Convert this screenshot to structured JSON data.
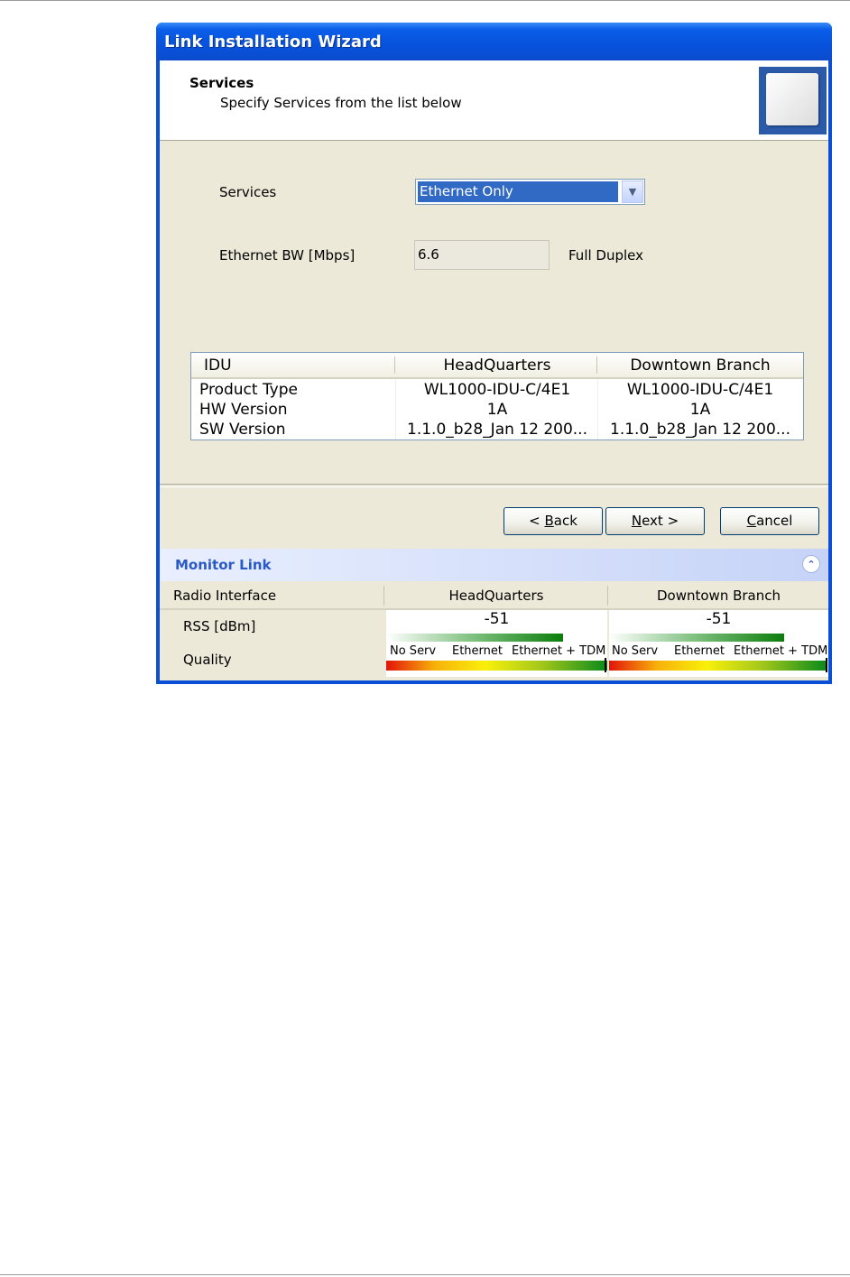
{
  "window": {
    "title": "Link Installation Wizard"
  },
  "header": {
    "title": "Services",
    "subtitle": "Specify Services from the list below"
  },
  "form": {
    "services_label": "Services",
    "services_value": "Ethernet Only",
    "bw_label": "Ethernet BW [Mbps]",
    "bw_value": "6.6",
    "duplex_label": "Full Duplex"
  },
  "idu_table": {
    "headers": [
      "IDU",
      "HeadQuarters",
      "Downtown Branch"
    ],
    "rows": [
      [
        "Product Type",
        "WL1000-IDU-C/4E1",
        "WL1000-IDU-C/4E1"
      ],
      [
        "HW Version",
        "1A",
        "1A"
      ],
      [
        "SW Version",
        "1.1.0_b28_Jan 12 200...",
        "1.1.0_b28_Jan 12 200..."
      ]
    ]
  },
  "buttons": {
    "back": {
      "pre": "< ",
      "accel": "B",
      "rest": "ack"
    },
    "next": {
      "pre": "",
      "accel": "N",
      "rest": "ext >"
    },
    "cancel": {
      "pre": "",
      "accel": "C",
      "rest": "ancel"
    }
  },
  "monitor": {
    "title": "Monitor Link",
    "headers": [
      "Radio Interface",
      "HeadQuarters",
      "Downtown Branch"
    ],
    "rss_label": "RSS [dBm]",
    "quality_label": "Quality",
    "sites": [
      {
        "rss": "-51",
        "rss_fill": 0.8,
        "quality_level": 1.0
      },
      {
        "rss": "-51",
        "rss_fill": 0.8,
        "quality_level": 1.0
      }
    ],
    "quality_scale": [
      "No Serv",
      "Ethernet",
      "Ethernet + TDM"
    ]
  },
  "colors": {
    "title_bar": "#0752dc",
    "selection": "#316ac5",
    "monitor_title": "#2a59c8"
  },
  "icons": {
    "dropdown": "chevron-down-icon",
    "collapse": "double-chevron-up-icon"
  }
}
